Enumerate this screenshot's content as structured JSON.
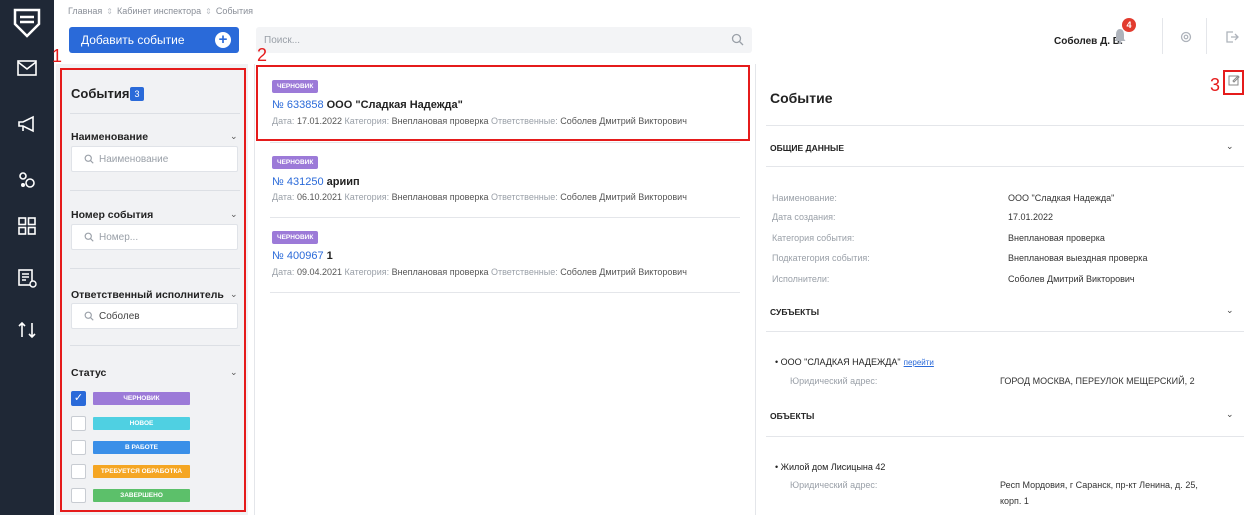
{
  "breadcrumb": [
    "Главная",
    "Кабинет инспектора",
    "События"
  ],
  "add_button": "Добавить событие",
  "search_placeholder": "Поиск...",
  "user_name": "Соболев Д. В.",
  "notification_count": "4",
  "annotations": [
    "1",
    "2",
    "3"
  ],
  "filters": {
    "title": "События",
    "count": "3",
    "name_label": "Наименование",
    "name_placeholder": "Наименование",
    "number_label": "Номер события",
    "number_placeholder": "Номер...",
    "responsible_label": "Ответственный исполнитель",
    "responsible_value": "Соболев",
    "status_label": "Статус",
    "statuses": [
      {
        "label": "ЧЕРНОВИК",
        "color": "#9c7ad8",
        "checked": true
      },
      {
        "label": "НОВОЕ",
        "color": "#4fd0e2",
        "checked": false
      },
      {
        "label": "В РАБОТЕ",
        "color": "#3a8fe8",
        "checked": false
      },
      {
        "label": "ТРЕБУЕТСЯ ОБРАБОТКА",
        "color": "#f5a623",
        "checked": false
      },
      {
        "label": "ЗАВЕРШЕНО",
        "color": "#5cc06a",
        "checked": false
      }
    ]
  },
  "meta_labels": {
    "date": "Дата:",
    "category": "Категория:",
    "responsible": "Ответственные:"
  },
  "events": [
    {
      "tag": "ЧЕРНОВИК",
      "number": "№ 633858",
      "name": "ООО \"Сладкая Надежда\"",
      "date": "17.01.2022",
      "category": "Внеплановая проверка",
      "responsible": "Соболев Дмитрий Викторович"
    },
    {
      "tag": "ЧЕРНОВИК",
      "number": "№ 431250",
      "name": "ариип",
      "date": "06.10.2021",
      "category": "Внеплановая проверка",
      "responsible": "Соболев Дмитрий Викторович"
    },
    {
      "tag": "ЧЕРНОВИК",
      "number": "№ 400967",
      "name": "1",
      "date": "09.04.2021",
      "category": "Внеплановая проверка",
      "responsible": "Соболев Дмитрий Викторович"
    }
  ],
  "detail": {
    "title": "Событие",
    "general_section": "ОБЩИЕ ДАННЫЕ",
    "fields": [
      {
        "key": "Наименование:",
        "value": "ООО \"Сладкая Надежда\""
      },
      {
        "key": "Дата создания:",
        "value": "17.01.2022"
      },
      {
        "key": "Категория события:",
        "value": "Внеплановая проверка"
      },
      {
        "key": "Подкатегория события:",
        "value": "Внеплановая выездная проверка"
      },
      {
        "key": "Исполнители:",
        "value": "Соболев Дмитрий Викторович"
      }
    ],
    "subjects_section": "СУБЪЕКТЫ",
    "subject_name": "ООО \"СЛАДКАЯ НАДЕЖДА\"",
    "subject_link": "перейти",
    "subject_address_key": "Юридический адрес:",
    "subject_address": "ГОРОД МОСКВА, ПЕРЕУЛОК МЕЩЕРСКИЙ, 2",
    "objects_section": "ОБЪЕКТЫ",
    "object_name": "Жилой дом Лисицына 42",
    "object_address_key": "Юридический адрес:",
    "object_address_line1": "Респ Мордовия, г Саранск, пр-кт Ленина, д. 25,",
    "object_address_line2": "корп. 1"
  }
}
